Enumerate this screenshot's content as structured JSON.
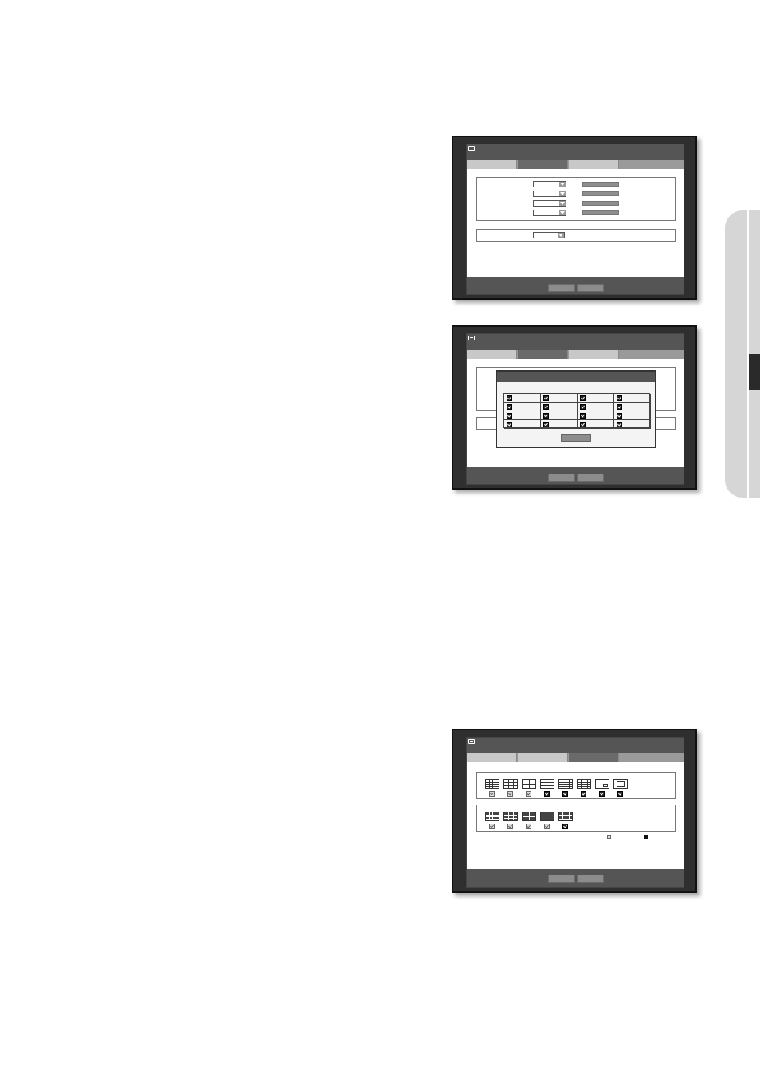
{
  "side_tab": {
    "color": "#d6d6d6",
    "marker_color": "#2a2a2a"
  },
  "screen1": {
    "tabs": [
      "",
      "",
      ""
    ],
    "active_tab": 1,
    "dropdown_rows": 4,
    "footer_buttons": [
      "",
      ""
    ]
  },
  "screen2": {
    "tabs": [
      "",
      "",
      ""
    ],
    "active_tab": 1,
    "popup": {
      "rows": 4,
      "columns": 4,
      "all_checked": true,
      "ok_label": ""
    },
    "footer_buttons": [
      "",
      ""
    ]
  },
  "screen3": {
    "tabs": [
      "",
      "",
      ""
    ],
    "active_tab": 2,
    "row1_layouts": [
      "grid-16",
      "grid-9",
      "grid-4",
      "grid-6",
      "grid-8",
      "grid-13",
      "pip",
      "sequence"
    ],
    "row1_checked": [
      false,
      false,
      false,
      true,
      true,
      true,
      true,
      true
    ],
    "row2_layouts": [
      "grid-16-dark",
      "grid-9-dark",
      "grid-4-dark",
      "single-dark",
      "grid-10-dark"
    ],
    "row2_checked": [
      false,
      false,
      false,
      false,
      true
    ],
    "legend": [
      "unchecked",
      "checked"
    ],
    "footer_buttons": [
      "",
      ""
    ]
  }
}
